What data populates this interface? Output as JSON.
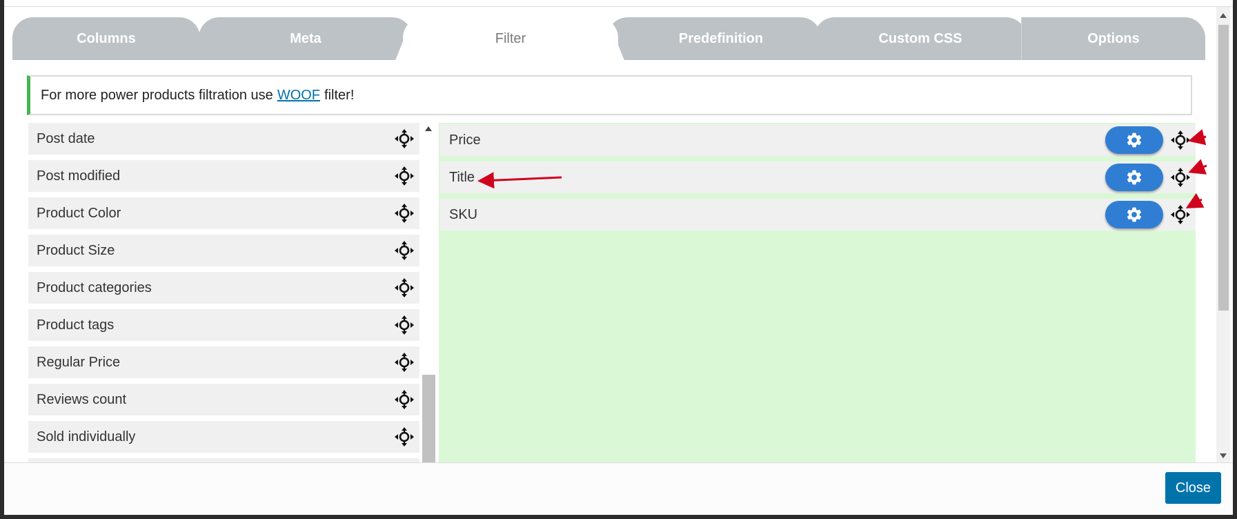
{
  "tabs": [
    {
      "label": "Columns"
    },
    {
      "label": "Meta"
    },
    {
      "label": "Filter"
    },
    {
      "label": "Predefinition"
    },
    {
      "label": "Custom CSS"
    },
    {
      "label": "Options"
    }
  ],
  "active_tab": "Filter",
  "notice": {
    "text_before": "For more power products filtration use",
    "link_text": "WOOF",
    "text_after": "filter!"
  },
  "available_fields": [
    {
      "label": "Post date"
    },
    {
      "label": "Post modified"
    },
    {
      "label": "Product Color"
    },
    {
      "label": "Product Size"
    },
    {
      "label": "Product categories"
    },
    {
      "label": "Product tags"
    },
    {
      "label": "Regular Price"
    },
    {
      "label": "Reviews count"
    },
    {
      "label": "Sold individually"
    },
    {
      "label": ""
    }
  ],
  "selected_fields": [
    {
      "label": "Price"
    },
    {
      "label": "Title"
    },
    {
      "label": "SKU"
    }
  ],
  "footer": {
    "close_label": "Close"
  },
  "icons": {
    "move": "move-arrows-icon",
    "settings": "gear-icon"
  },
  "colors": {
    "tab_inactive": "#bdc2c7",
    "notice_border": "#46b450",
    "settings_button": "#2f7ed3",
    "drop_zone": "#daf8d6",
    "close_button": "#0073aa",
    "annotation_arrow": "#d0021b"
  }
}
